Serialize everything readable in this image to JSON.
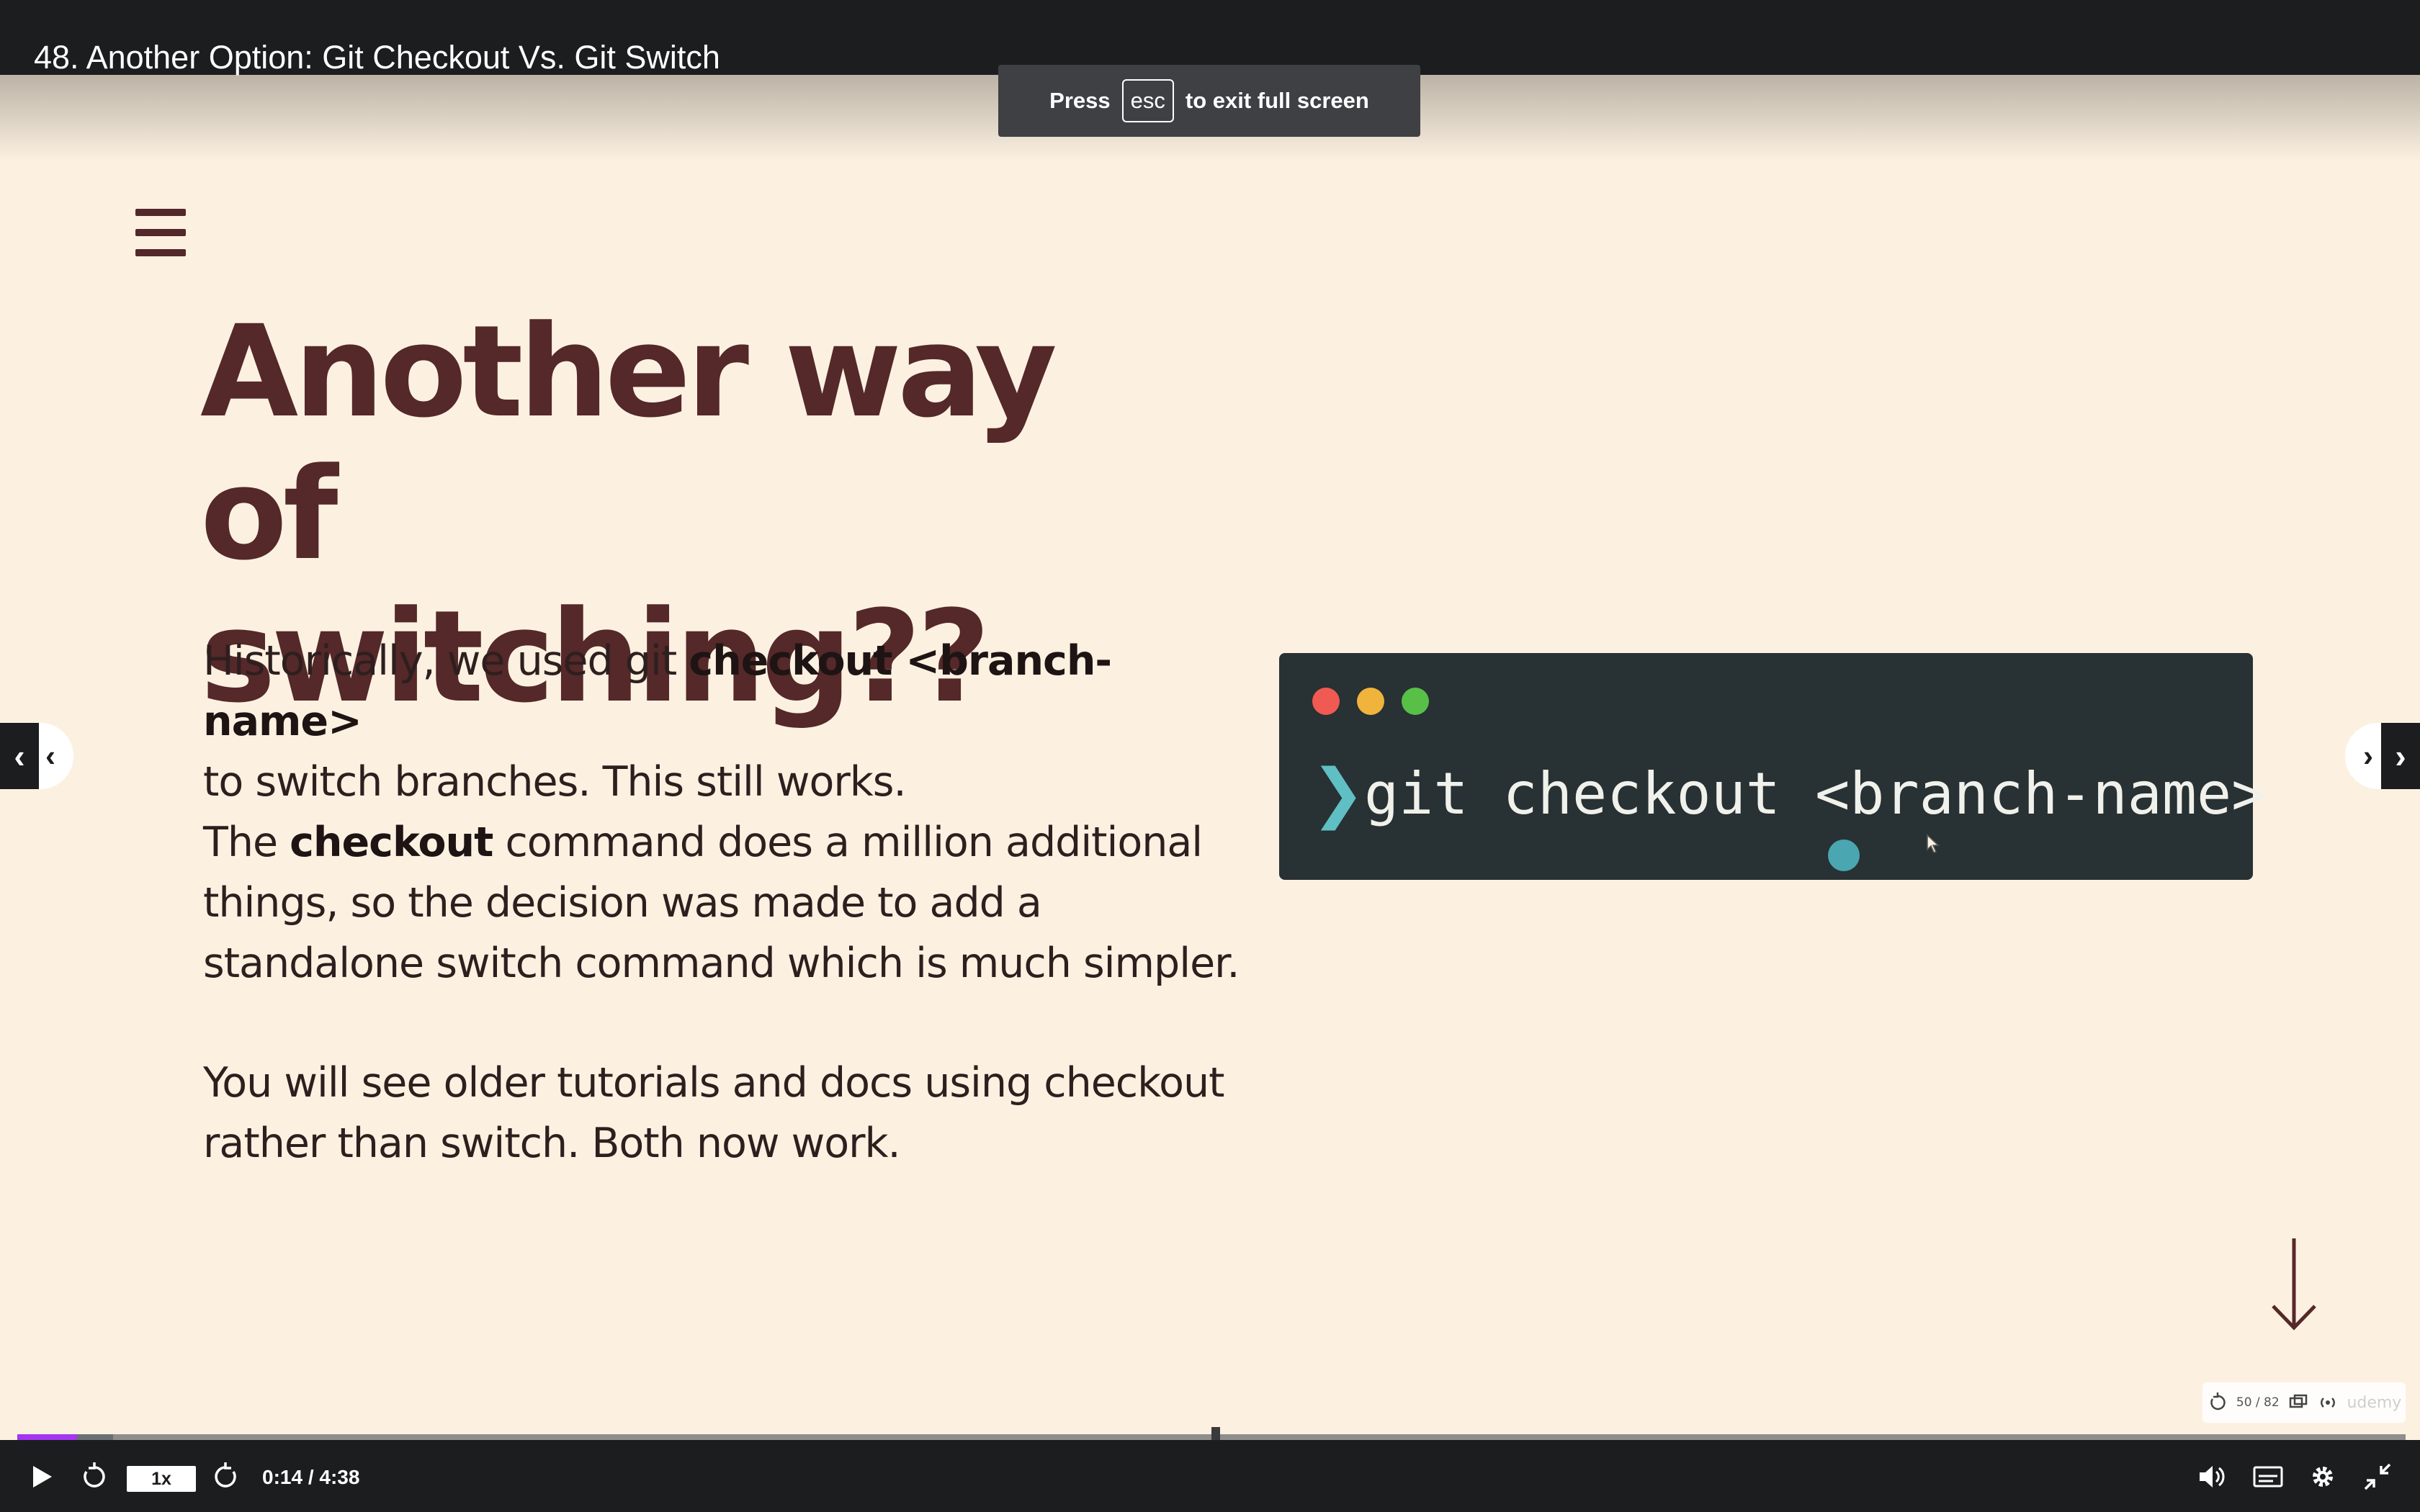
{
  "header": {
    "lecture_title": "48. Another Option: Git Checkout Vs. Git Switch"
  },
  "fullscreen_toast": {
    "prefix": "Press",
    "key": "esc",
    "suffix": "to exit full screen"
  },
  "slide": {
    "title_line1": "Another way of",
    "title_line2": "switching??",
    "paragraph1": {
      "t1": "Historically, we used git ",
      "b1": "checkout <branch-name>",
      "t2": "to switch branches.  This still works."
    },
    "paragraph2": {
      "t1": "The ",
      "b1": "checkout",
      "t2": " command does a million additional",
      "t3": "things, so the decision was made to add a",
      "t4": "standalone switch command which is much simpler."
    },
    "paragraph3": {
      "line1": "You will see older tutorials and docs using checkout",
      "line2": "rather than switch.  Both now work."
    },
    "terminal": {
      "prompt_glyph": "❯",
      "command": "git checkout <branch-name>"
    },
    "mini_toolbar": {
      "slide_counter": "50 / 82",
      "watermark": "udemy"
    }
  },
  "nav": {
    "prev_glyph": "‹",
    "next_glyph": "›"
  },
  "player": {
    "speed": "1x",
    "time": "0:14 / 4:38",
    "progress_played_fraction": 0.025,
    "progress_buffered_fraction": 0.04,
    "accent_color": "#a435f0"
  },
  "colors": {
    "slide_background": "#fcf1e1",
    "title_color": "#55282a",
    "terminal_background": "#283133"
  }
}
